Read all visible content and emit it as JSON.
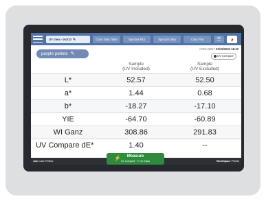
{
  "topbar": {
    "active_tab": "UV View - 063/10",
    "tabs": [
      "Color Data Table",
      "Spectral Plot",
      "Spectral Data",
      "Color Plot"
    ],
    "icons": [
      "menu-icon",
      "pencil-icon",
      "list-icon",
      "color-wheel-icon"
    ]
  },
  "sample": {
    "name": "purple pellets",
    "instrument_id": "AGRL20017",
    "datetime": "02/16/2024 18:32",
    "uv_compare_label": "UV Compare"
  },
  "table": {
    "columns": [
      "Sample\n(UV Included)",
      "Sample\n(UV Excluded)"
    ],
    "col1_line1": "Sample",
    "col1_line2": "(UV Included)",
    "col2_line1": "Sample",
    "col2_line2": "(UV Excluded)",
    "rows": [
      {
        "label": "L*",
        "v1": "52.57",
        "v2": "52.50"
      },
      {
        "label": "a*",
        "v1": "1.44",
        "v2": "0.68"
      },
      {
        "label": "b*",
        "v1": "-18.27",
        "v2": "-17.10"
      },
      {
        "label": "YIE",
        "v1": "-64.70",
        "v2": "-60.89"
      },
      {
        "label": "WI Ganz",
        "v1": "308.86",
        "v2": "291.83"
      },
      {
        "label": "UV Compare dE*",
        "v1": "1.40",
        "v2": "--"
      }
    ]
  },
  "measure": {
    "label": "Measure",
    "sub": "UV Compare · 2° w/ Glass"
  },
  "footer": {
    "job_label": "Job",
    "job_value": "Color Pellets",
    "workspace_label": "WorkSpace",
    "workspace_value": "Pellets"
  },
  "colors": {
    "topbar": "#5271a4",
    "pill": "#7189b4",
    "measure": "#2e8a3c",
    "footer": "#2d3035"
  }
}
